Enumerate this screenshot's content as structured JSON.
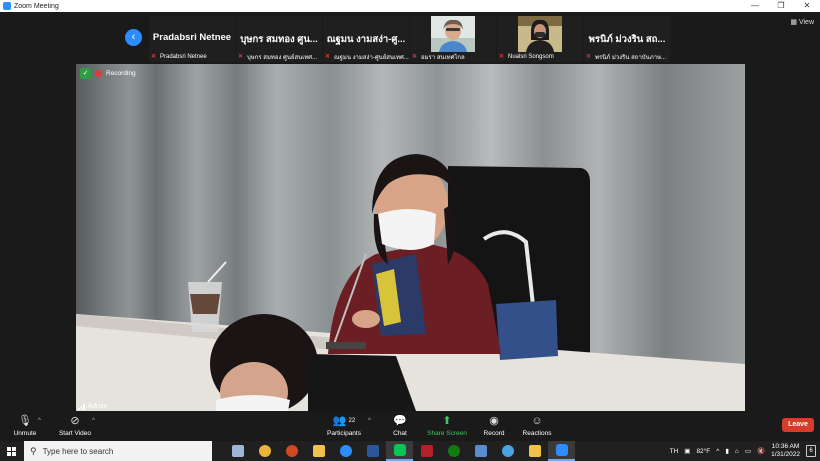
{
  "window": {
    "title": "Zoom Meeting",
    "minimize": "—",
    "restore": "❐",
    "close": "✕"
  },
  "strip": {
    "view_label": "View",
    "prev_arrow": "‹",
    "tiles": [
      {
        "big": "Pradabsri Netnee",
        "caption": "Pradabsri Netnee"
      },
      {
        "big": "บุษกร สมทอง ศูน...",
        "caption": "บุษกร สมทอง ศูนย์สนเทศ..."
      },
      {
        "big": "ณฐมน งามสง่า-ศู...",
        "caption": "ณฐมน งามสง่า-ศูนย์สนเทศ..."
      },
      {
        "big": "",
        "caption": "อมรา สนเทศไกล"
      },
      {
        "big": "",
        "caption": "Nualsri Songsom"
      },
      {
        "big": "พรนิภ์ ม่วงริน สถ...",
        "caption": "พรนิภ์ ม่วงริน สถาบันภาษ..."
      }
    ]
  },
  "video": {
    "recording_label": "Recording",
    "speaker_name": "Admin"
  },
  "controls": {
    "unmute": "Unmute",
    "start_video": "Start Video",
    "participants": "Participants",
    "participants_count": "22",
    "chat": "Chat",
    "share_screen": "Share Screen",
    "record": "Record",
    "reactions": "Reactions",
    "leave": "Leave"
  },
  "taskbar": {
    "search_placeholder": "Type here to search",
    "language": "TH",
    "temperature": "82°F",
    "time": "10:36 AM",
    "date": "1/31/2022",
    "notifications": "6"
  },
  "colors": {
    "accent": "#2d8cff",
    "record_red": "#e03a3a",
    "share_green": "#48c268",
    "leave_red": "#d93b2b"
  }
}
